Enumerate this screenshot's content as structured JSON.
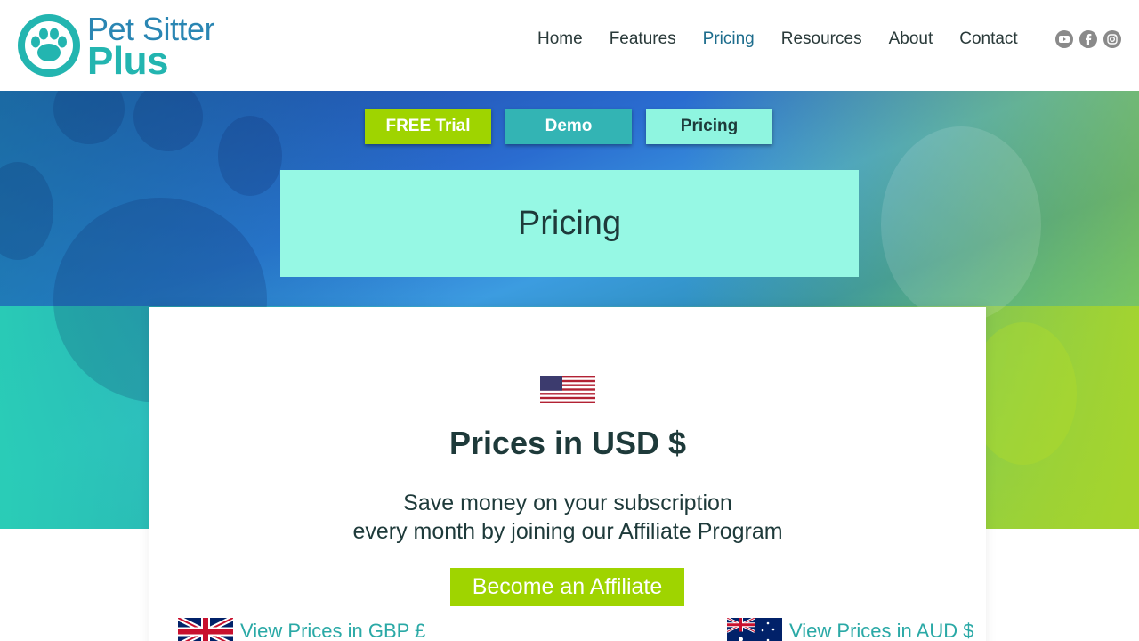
{
  "header": {
    "logo_line1": "Pet Sitter",
    "logo_line2": "Plus",
    "nav": [
      "Home",
      "Features",
      "Pricing",
      "Resources",
      "About",
      "Contact"
    ],
    "active_nav": "Pricing",
    "social_icons": [
      "youtube-icon",
      "facebook-icon",
      "instagram-icon"
    ]
  },
  "hero": {
    "buttons": {
      "trial": "FREE Trial",
      "demo": "Demo",
      "pricing": "Pricing"
    },
    "title": "Pricing"
  },
  "card": {
    "heading": "Prices in USD $",
    "subtitle_line1": "Save money on your subscription",
    "subtitle_line2": "every month by joining our Affiliate Program",
    "affiliate_button": "Become an Affiliate",
    "gbp_link": "View Prices in GBP £",
    "aud_link": "View Prices in AUD $"
  },
  "colors": {
    "brand_teal": "#23b5b0",
    "brand_blue": "#2a86b3",
    "lime": "#9fd400",
    "mint": "#96f8e4"
  }
}
